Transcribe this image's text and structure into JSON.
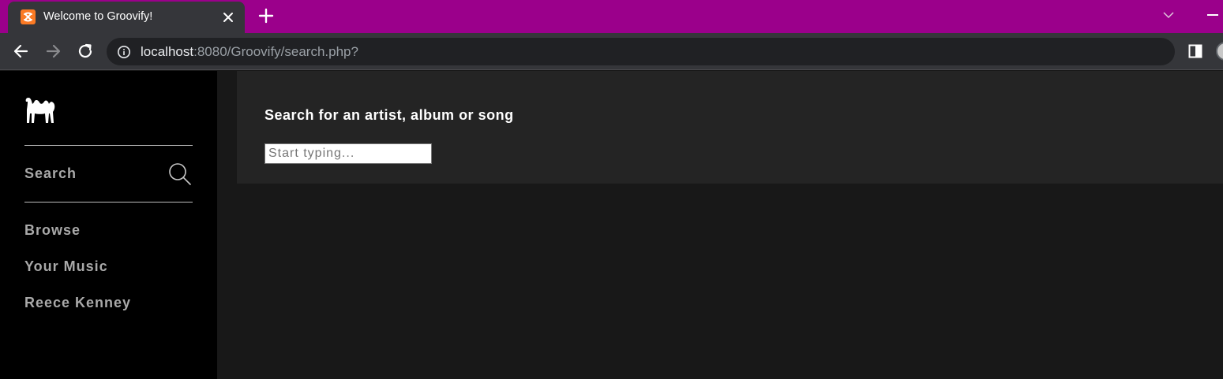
{
  "browser": {
    "tab_title": "Welcome to Groovify!",
    "url_host": "localhost",
    "url_rest": ":8080/Groovify/search.php?"
  },
  "sidebar": {
    "nav": [
      {
        "label": "Search"
      },
      {
        "label": "Browse"
      },
      {
        "label": "Your Music"
      },
      {
        "label": "Reece Kenney"
      }
    ]
  },
  "main": {
    "heading": "Search for an artist, album or song",
    "search_placeholder": "Start typing...",
    "search_value": ""
  },
  "colors": {
    "tab_strip": "#9b008b",
    "sidebar_bg": "#000000",
    "panel_bg": "#242424",
    "page_bg": "#181818",
    "nav_text": "#a9a9a9"
  },
  "icons": {
    "logo": "camel-icon",
    "search": "search-icon"
  }
}
